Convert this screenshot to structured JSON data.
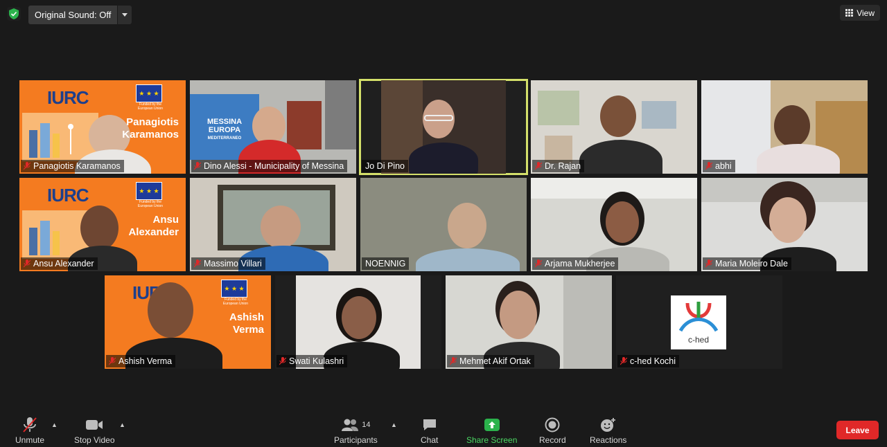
{
  "top": {
    "original_sound": "Original Sound: Off",
    "view_label": "View"
  },
  "tiles": [
    {
      "name": "Panagiotis Karamanos",
      "muted": true,
      "card_title_1": "Panagiotis",
      "card_title_2": "Karamanos",
      "logo": "IURC",
      "funded": "Funded by the European Union"
    },
    {
      "name": "Dino Alessi - Municipality of Messina",
      "muted": true,
      "poster_1": "MESSINA",
      "poster_2": "EUROPA",
      "poster_3": "MEDITERRANEO"
    },
    {
      "name": "Jo Di Pino",
      "muted": false,
      "active": true
    },
    {
      "name": "Dr. Rajan",
      "muted": true
    },
    {
      "name": "abhi",
      "muted": true
    },
    {
      "name": "Ansu Alexander",
      "muted": true,
      "card_title_1": "Ansu",
      "card_title_2": "Alexander",
      "logo": "IURC",
      "funded": "Funded by the European Union"
    },
    {
      "name": "Massimo Villari",
      "muted": true
    },
    {
      "name": "NOENNIG",
      "muted": false
    },
    {
      "name": "Arjama Mukherjee",
      "muted": true
    },
    {
      "name": "Maria Moleiro Dale",
      "muted": true
    },
    {
      "name": "Ashish Verma",
      "muted": true,
      "card_title_1": "Ashish",
      "card_title_2": "Verma",
      "logo": "IURC",
      "funded": "Funded by the European Union"
    },
    {
      "name": "Swati Kulashri",
      "muted": true
    },
    {
      "name": "Mehmet Akif Ortak",
      "muted": true
    },
    {
      "name": "c-hed Kochi",
      "muted": true,
      "logo_text": "c-hed"
    }
  ],
  "toolbar": {
    "unmute": "Unmute",
    "stop_video": "Stop Video",
    "participants": "Participants",
    "participants_count": "14",
    "chat": "Chat",
    "share_screen": "Share Screen",
    "record": "Record",
    "reactions": "Reactions",
    "leave": "Leave"
  },
  "colors": {
    "accent_green": "#4cd964",
    "leave_red": "#e02828",
    "active_speaker": "#d4e06a",
    "iurc_orange": "#f47b20"
  }
}
